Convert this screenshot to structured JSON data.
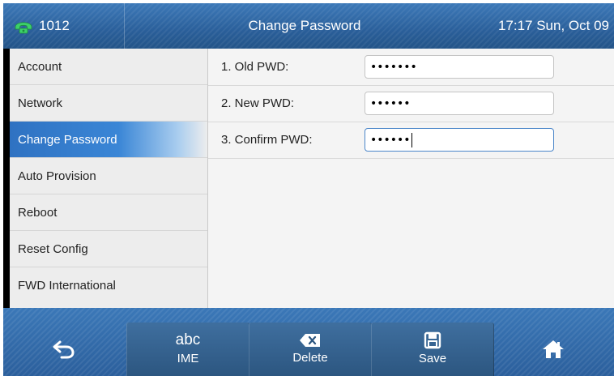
{
  "status_bar": {
    "account": "1012",
    "title": "Change Password",
    "datetime": "17:17 Sun, Oct 09"
  },
  "menu": {
    "items": [
      {
        "label": "Account"
      },
      {
        "label": "Network"
      },
      {
        "label": "Change Password",
        "active": true
      },
      {
        "label": "Auto Provision"
      },
      {
        "label": "Reboot"
      },
      {
        "label": "Reset Config"
      },
      {
        "label": "FWD International"
      }
    ]
  },
  "form": {
    "old_pwd": {
      "label": "1. Old PWD:",
      "value": "•••••••"
    },
    "new_pwd": {
      "label": "2. New PWD:",
      "value": "••••••"
    },
    "confirm_pwd": {
      "label": "3. Confirm PWD:",
      "value": "••••••"
    }
  },
  "softkeys": {
    "back": {
      "icon": "back-arrow-icon"
    },
    "ime": {
      "top": "abc",
      "label": "IME"
    },
    "delete": {
      "icon": "backspace-icon",
      "label": "Delete"
    },
    "save": {
      "icon": "floppy-disk-icon",
      "label": "Save"
    },
    "home": {
      "icon": "home-icon"
    }
  },
  "colors": {
    "accent": "#2f72c2",
    "bar": "#2a5f9a"
  }
}
